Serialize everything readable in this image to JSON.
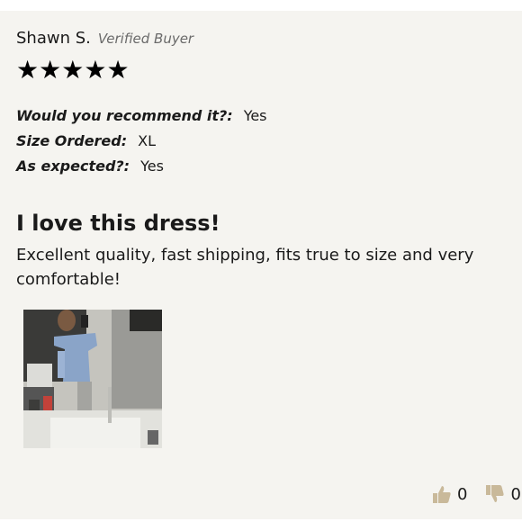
{
  "review": {
    "reviewer_name": "Shawn S.",
    "verified_label": "Verified Buyer",
    "rating": 5,
    "star_glyph": "★",
    "questions": [
      {
        "label": "Would you recommend it?:",
        "value": "Yes"
      },
      {
        "label": "Size Ordered:",
        "value": "XL"
      },
      {
        "label": "As expected?:",
        "value": "Yes"
      }
    ],
    "title": "I love this dress!",
    "body": "Excellent quality, fast shipping, fits true to size and very comfortable!",
    "photo_icon": "customer-photo",
    "votes": {
      "helpful_icon": "thumbs-up-icon",
      "helpful_count": "0",
      "unhelpful_icon": "thumbs-down-icon",
      "unhelpful_count": "0"
    },
    "colors": {
      "card_bg": "#f5f4f0",
      "star": "#000000",
      "thumb": "#c9b99a"
    }
  }
}
